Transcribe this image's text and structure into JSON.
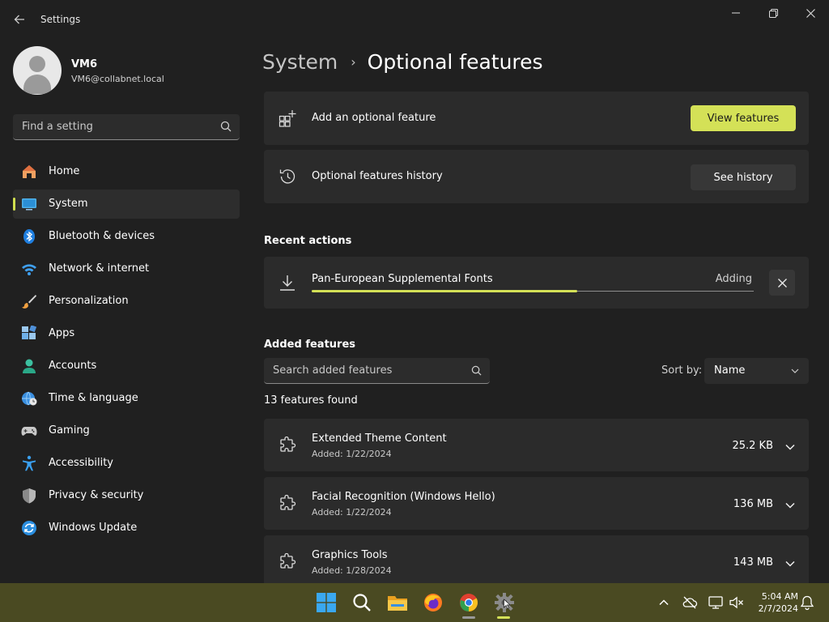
{
  "window": {
    "title": "Settings",
    "back_icon": "back-arrow-icon",
    "controls": [
      "minimize-icon",
      "restore-icon",
      "close-icon"
    ]
  },
  "profile": {
    "name": "VM6",
    "email": "VM6@collabnet.local"
  },
  "search": {
    "placeholder": "Find a setting"
  },
  "sidebar": {
    "active": "System",
    "accent_color": "#d0df4f",
    "items": [
      {
        "label": "Home",
        "icon": "home-icon"
      },
      {
        "label": "System",
        "icon": "system-icon"
      },
      {
        "label": "Bluetooth & devices",
        "icon": "bluetooth-icon"
      },
      {
        "label": "Network & internet",
        "icon": "wifi-icon"
      },
      {
        "label": "Personalization",
        "icon": "brush-icon"
      },
      {
        "label": "Apps",
        "icon": "apps-icon"
      },
      {
        "label": "Accounts",
        "icon": "accounts-icon"
      },
      {
        "label": "Time & language",
        "icon": "globe-clock-icon"
      },
      {
        "label": "Gaming",
        "icon": "gamepad-icon"
      },
      {
        "label": "Accessibility",
        "icon": "accessibility-icon"
      },
      {
        "label": "Privacy & security",
        "icon": "shield-icon"
      },
      {
        "label": "Windows Update",
        "icon": "update-icon"
      }
    ]
  },
  "breadcrumb": {
    "parent": "System",
    "separator": "›",
    "current": "Optional features"
  },
  "cards": {
    "add": {
      "title": "Add an optional feature",
      "button": "View features",
      "icon": "add-feature-icon"
    },
    "history": {
      "title": "Optional features history",
      "button": "See history",
      "icon": "history-icon"
    }
  },
  "recent": {
    "heading": "Recent actions",
    "item": {
      "name": "Pan-European Supplemental Fonts",
      "status": "Adding",
      "progress_percent": 60,
      "icon": "download-icon",
      "cancel_icon": "close-icon"
    }
  },
  "added": {
    "heading": "Added features",
    "search_placeholder": "Search added features",
    "sort_label": "Sort by:",
    "sort_value": "Name",
    "count_text": "13 features found",
    "features": [
      {
        "name": "Extended Theme Content",
        "added": "Added: 1/22/2024",
        "size": "25.2 KB"
      },
      {
        "name": "Facial Recognition (Windows Hello)",
        "added": "Added: 1/22/2024",
        "size": "136 MB"
      },
      {
        "name": "Graphics Tools",
        "added": "Added: 1/28/2024",
        "size": "143 MB"
      }
    ]
  },
  "taskbar": {
    "apps": [
      "windows-start-icon",
      "search-icon",
      "file-explorer-icon",
      "firefox-icon",
      "chrome-icon",
      "settings-icon"
    ],
    "clock_time": "5:04 AM",
    "clock_date": "2/7/2024",
    "bg_color": "#4a4a22"
  }
}
